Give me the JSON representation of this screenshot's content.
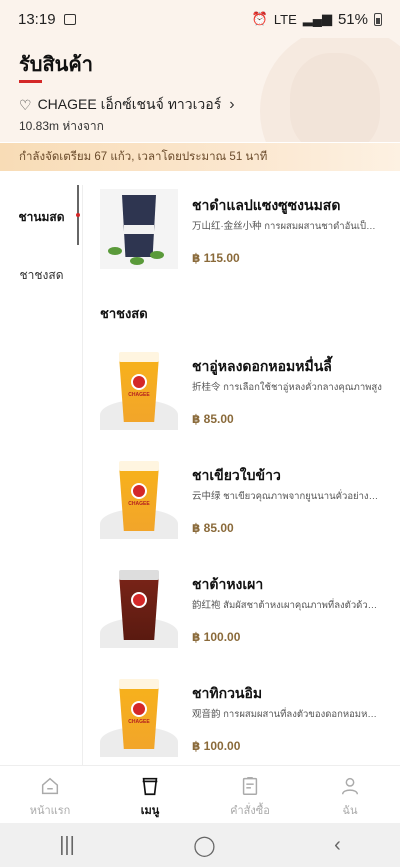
{
  "status_bar": {
    "time": "13:19",
    "network": "LTE",
    "battery": "51%"
  },
  "header": {
    "title": "รับสินค้า",
    "store_name": "CHAGEE เอ็กซ์เชนจ์ ทาวเวอร์",
    "distance": "10.83m ห่างจาก"
  },
  "notice": {
    "text": "กำลังจัดเตรียม 67 แก้ว, เวลาโดยประมาณ 51 นาที"
  },
  "sidebar": {
    "items": [
      {
        "label": "ชานมสด",
        "active": true
      },
      {
        "label": "ชาชงสด",
        "active": false
      }
    ]
  },
  "sections": [
    {
      "title": "ชาชงสด"
    }
  ],
  "products": [
    {
      "name": "ชาดำแลปแซงซูซงนมสด",
      "desc": "万山红·金丝小种 การผสมผสานชาดำอันเป็นเอกลักษณ์",
      "price": "฿ 115.00",
      "cup_color": "#2e3550"
    },
    {
      "name": "ชาอู่หลงดอกหอมหมื่นลี้",
      "desc": "折桂令 การเลือกใช้ชาอู่หลงคั่วกลางคุณภาพสูง",
      "price": "฿ 85.00",
      "cup_color": "#f7b21b"
    },
    {
      "name": "ชาเขียวใบข้าว",
      "desc": "云中绿 ชาเขียวคุณภาพจากยูนนานคั่วอย่างพิถีพิถัน",
      "price": "฿ 85.00",
      "cup_color": "#f7b21b"
    },
    {
      "name": "ชาต้าหงเผา",
      "desc": "韵红袍 สัมผัสชาต้าหงเผาคุณภาพที่ลงตัวด้วยกลิ่นหอม",
      "price": "฿ 100.00",
      "cup_color": "#7a2418"
    },
    {
      "name": "ชาทิกวนอิม",
      "desc": "观音韵 การผสมผสานที่ลงตัวของดอกหอมหมื่นลี้",
      "price": "฿ 100.00",
      "cup_color": "#f7b21b"
    }
  ],
  "cup_brand": "CHAGEE",
  "bottom_nav": [
    {
      "label": "หน้าแรก",
      "icon": "home-icon",
      "active": false
    },
    {
      "label": "เมนู",
      "icon": "cup-icon",
      "active": true
    },
    {
      "label": "คำสั่งซื้อ",
      "icon": "order-icon",
      "active": false
    },
    {
      "label": "ฉัน",
      "icon": "profile-icon",
      "active": false
    }
  ],
  "colors": {
    "accent": "#d42828",
    "header_bg": "#fbf3ec",
    "price": "#8a6a3a"
  }
}
